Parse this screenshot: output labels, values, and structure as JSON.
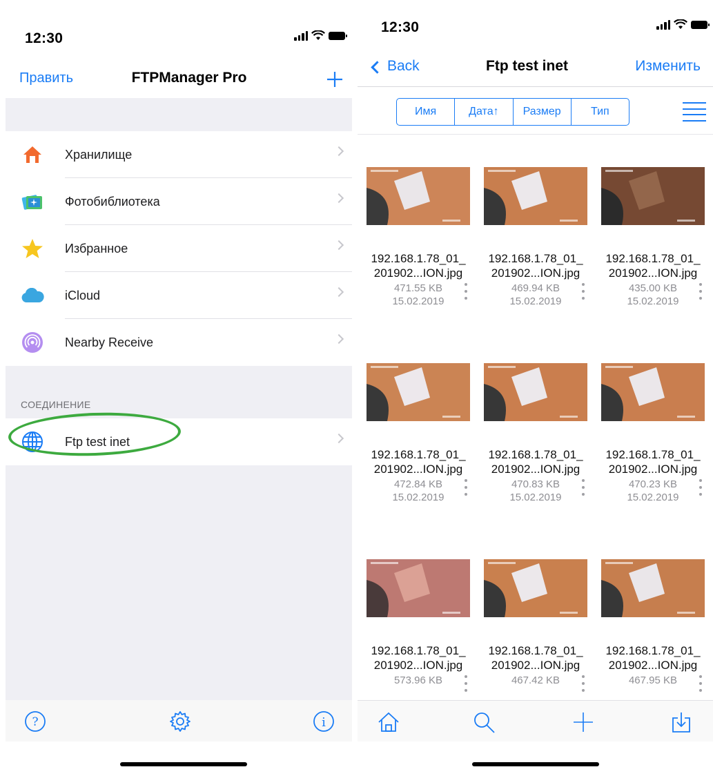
{
  "left": {
    "status": {
      "time": "12:30"
    },
    "navbar": {
      "edit_label": "Править",
      "title": "FTPManager Pro",
      "add_icon": "plus-icon"
    },
    "places": [
      {
        "label": "Хранилище",
        "icon": "house-icon"
      },
      {
        "label": "Фотобиблиотека",
        "icon": "photo-library-icon"
      },
      {
        "label": "Избранное",
        "icon": "star-icon"
      },
      {
        "label": "iCloud",
        "icon": "cloud-icon"
      },
      {
        "label": "Nearby Receive",
        "icon": "airdrop-icon"
      }
    ],
    "connections": {
      "header": "СОЕДИНЕНИЕ",
      "items": [
        {
          "label": "Ftp test inet",
          "icon": "globe-icon"
        }
      ]
    },
    "highlight_color": "#3daa3f",
    "tabbar": [
      "help-icon",
      "settings-gear-icon",
      "info-icon"
    ]
  },
  "right": {
    "status": {
      "time": "12:30"
    },
    "navbar": {
      "back_label": "Back",
      "title": "Ftp test inet",
      "edit_label": "Изменить"
    },
    "sort": {
      "name": "Имя",
      "date": "Дата↑",
      "size": "Размер",
      "type": "Тип"
    },
    "files": [
      {
        "name1": "192.168.1.78_01_",
        "name2": "201902...ION.jpg",
        "size": "471.55 KB",
        "date": "15.02.2019"
      },
      {
        "name1": "192.168.1.78_01_",
        "name2": "201902...ION.jpg",
        "size": "469.94 KB",
        "date": "15.02.2019"
      },
      {
        "name1": "192.168.1.78_01_",
        "name2": "201902...ION.jpg",
        "size": "435.00 KB",
        "date": "15.02.2019"
      },
      {
        "name1": "192.168.1.78_01_",
        "name2": "201902...ION.jpg",
        "size": "472.84 KB",
        "date": "15.02.2019"
      },
      {
        "name1": "192.168.1.78_01_",
        "name2": "201902...ION.jpg",
        "size": "470.83 KB",
        "date": "15.02.2019"
      },
      {
        "name1": "192.168.1.78_01_",
        "name2": "201902...ION.jpg",
        "size": "470.23 KB",
        "date": "15.02.2019"
      },
      {
        "name1": "192.168.1.78_01_",
        "name2": "201902...ION.jpg",
        "size": "573.96 KB",
        "date": ""
      },
      {
        "name1": "192.168.1.78_01_",
        "name2": "201902...ION.jpg",
        "size": "467.42 KB",
        "date": ""
      },
      {
        "name1": "192.168.1.78_01_",
        "name2": "201902...ION.jpg",
        "size": "467.95 KB",
        "date": ""
      }
    ],
    "tabbar": [
      "home-icon",
      "search-icon",
      "plus-icon",
      "download-icon"
    ],
    "accent": "#1a7cf5"
  }
}
